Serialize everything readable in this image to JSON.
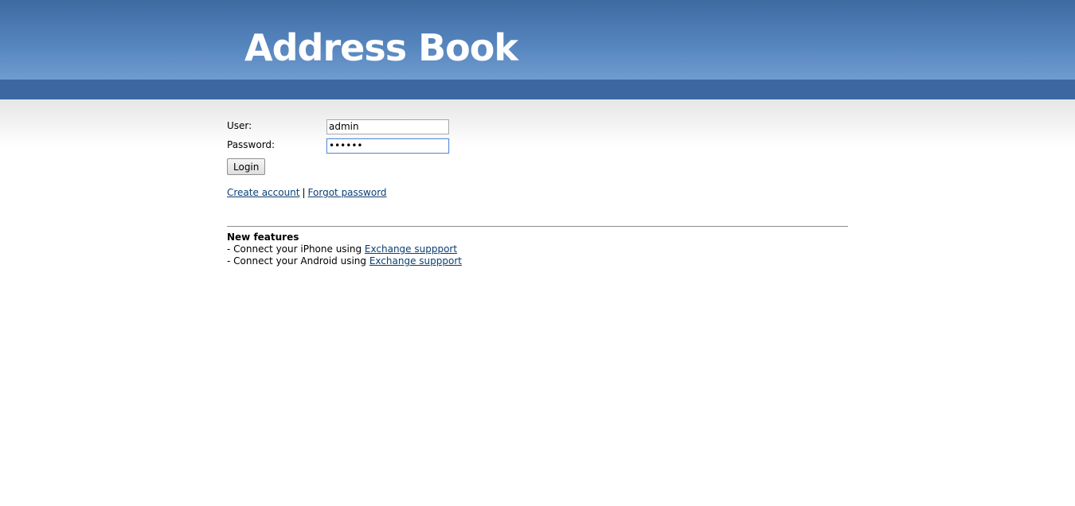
{
  "header": {
    "logo_text": "Address Book"
  },
  "login_form": {
    "user_label": "User:",
    "user_value": "admin",
    "password_label": "Password:",
    "password_value": "••••••",
    "login_button_label": "Login"
  },
  "links": {
    "create_account": "Create account",
    "separator": "|",
    "forgot_password": "Forgot password"
  },
  "features": {
    "title": "New features",
    "items": [
      {
        "prefix": "- Connect your iPhone using ",
        "link_text": "Exchange suppport"
      },
      {
        "prefix": "- Connect your Android using ",
        "link_text": "Exchange suppport"
      }
    ]
  },
  "colors": {
    "header_blue": "#3f6aa2",
    "bar_blue": "#3c67a0",
    "link": "#0b3f73"
  }
}
